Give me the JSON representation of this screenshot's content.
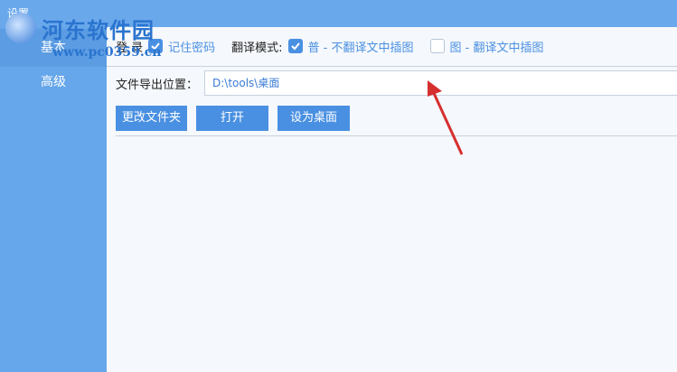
{
  "window": {
    "title": "设置"
  },
  "watermark": {
    "text": "河东软件园",
    "url": "www.pc0359.cn"
  },
  "sidebar": {
    "items": [
      {
        "label": "基本"
      },
      {
        "label": "高级"
      }
    ]
  },
  "options": {
    "login_label": "登  录",
    "remember_password": {
      "label": "记住密码",
      "checked": true
    },
    "translate_mode_label": "翻译模式:",
    "mode_normal": {
      "label": "普 - 不翻译文中插图",
      "checked": true
    },
    "mode_image": {
      "label": "图 - 翻译文中插图",
      "checked": false
    }
  },
  "export": {
    "label": "文件导出位置：",
    "value": "D:\\tools\\桌面"
  },
  "buttons": {
    "change_folder": "更改文件夹",
    "open": "打开",
    "set_desktop": "设为桌面"
  },
  "colors": {
    "accent": "#4a90e2",
    "sidebar": "#66a6ea",
    "arrow": "#d62f2f"
  }
}
